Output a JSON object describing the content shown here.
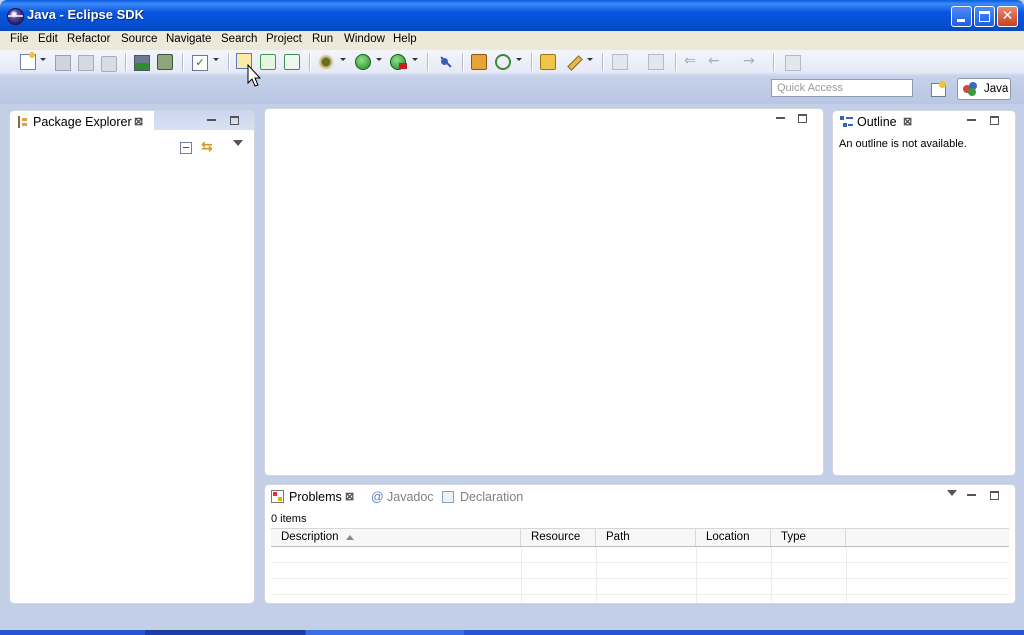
{
  "window": {
    "title": "Java - Eclipse SDK",
    "controls": {
      "close_glyph": "✕"
    }
  },
  "menu": {
    "items": [
      "File",
      "Edit",
      "Refactor",
      "Source",
      "Navigate",
      "Search",
      "Project",
      "Run",
      "Window",
      "Help"
    ]
  },
  "toolbar": {
    "quick_access_placeholder": "Quick Access",
    "perspective_label": "Java"
  },
  "package_explorer": {
    "title": "Package Explorer"
  },
  "outline": {
    "title": "Outline",
    "message": "An outline is not available."
  },
  "bottom": {
    "tabs": [
      "Problems",
      "Javadoc",
      "Declaration"
    ],
    "javadoc_glyph": "@",
    "item_count": "0 items",
    "columns": [
      "Description",
      "Resource",
      "Path",
      "Location",
      "Type"
    ]
  },
  "colors": {
    "title_bar": "#0a56df",
    "toolbar_bg": "#c7d2ea",
    "workbench_bg": "#c3cfe6",
    "inactive_tab_text": "#808080"
  }
}
